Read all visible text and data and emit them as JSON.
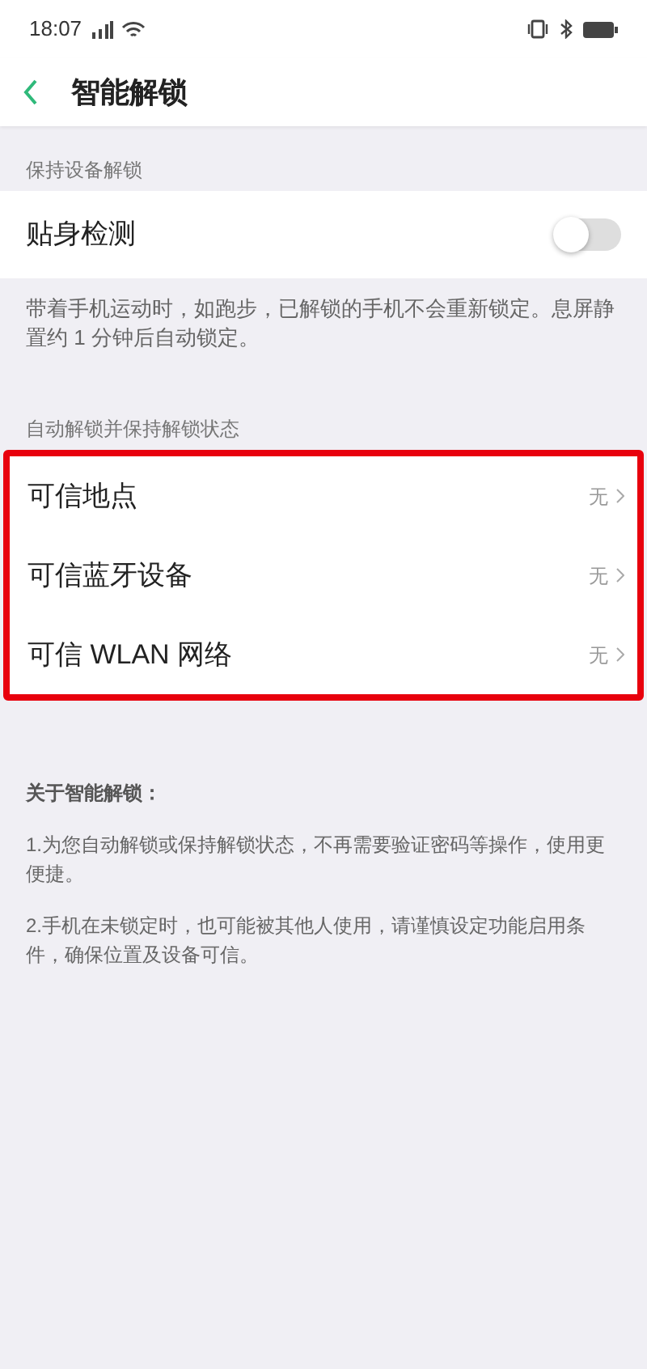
{
  "status_bar": {
    "time": "18:07"
  },
  "header": {
    "title": "智能解锁"
  },
  "sections": [
    {
      "title": "保持设备解锁",
      "rows": [
        {
          "kind": "toggle",
          "label": "贴身检测",
          "on": false
        }
      ],
      "note": "带着手机运动时，如跑步，已解锁的手机不会重新锁定。息屏静置约 1 分钟后自动锁定。",
      "highlighted": false
    },
    {
      "title": "自动解锁并保持解锁状态",
      "rows": [
        {
          "kind": "link",
          "label": "可信地点",
          "value": "无"
        },
        {
          "kind": "link",
          "label": "可信蓝牙设备",
          "value": "无"
        },
        {
          "kind": "link",
          "label": "可信 WLAN 网络",
          "value": "无"
        }
      ],
      "highlighted": true
    }
  ],
  "about": {
    "title": "关于智能解锁：",
    "paragraphs": [
      "1.为您自动解锁或保持解锁状态，不再需要验证密码等操作，使用更便捷。",
      "2.手机在未锁定时，也可能被其他人使用，请谨慎设定功能启用条件，确保位置及设备可信。"
    ]
  }
}
